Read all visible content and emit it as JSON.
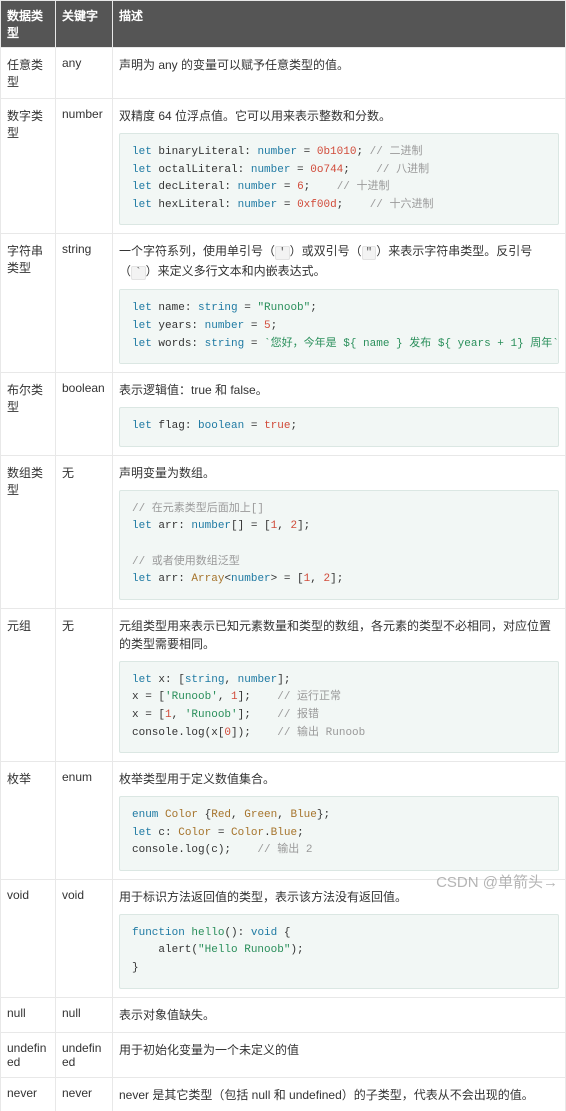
{
  "headers": {
    "col1": "数据类型",
    "col2": "关键字",
    "col3": "描述"
  },
  "rows": {
    "any": {
      "type": "任意类型",
      "kw": "any",
      "desc": "声明为 any 的变量可以赋予任意类型的值。"
    },
    "number": {
      "type": "数字类型",
      "kw": "number",
      "desc": "双精度 64 位浮点值。它可以用来表示整数和分数。",
      "code": {
        "l1a": "let",
        "l1b": " binaryLiteral: ",
        "l1c": "number",
        "l1d": " = ",
        "l1e": "0b1010",
        "l1f": "; ",
        "l1g": "// 二进制",
        "l2a": "let",
        "l2b": " octalLiteral: ",
        "l2c": "number",
        "l2d": " = ",
        "l2e": "0o744",
        "l2f": ";    ",
        "l2g": "// 八进制",
        "l3a": "let",
        "l3b": " decLiteral: ",
        "l3c": "number",
        "l3d": " = ",
        "l3e": "6",
        "l3f": ";    ",
        "l3g": "// 十进制",
        "l4a": "let",
        "l4b": " hexLiteral: ",
        "l4c": "number",
        "l4d": " = ",
        "l4e": "0xf00d",
        "l4f": ";    ",
        "l4g": "// 十六进制"
      }
    },
    "string": {
      "type": "字符串类型",
      "kw": "string",
      "desc_pre": "一个字符系列，使用单引号（",
      "q1": "'",
      "desc_mid1": "）或双引号（",
      "q2": "\"",
      "desc_mid2": "）来表示字符串类型。反引号（",
      "q3": "`",
      "desc_post": "）来定义多行文本和内嵌表达式。",
      "code": {
        "l1a": "let",
        "l1b": " name: ",
        "l1c": "string",
        "l1d": " = ",
        "l1e": "\"Runoob\"",
        "l1f": ";",
        "l2a": "let",
        "l2b": " years: ",
        "l2c": "number",
        "l2d": " = ",
        "l2e": "5",
        "l2f": ";",
        "l3a": "let",
        "l3b": " words: ",
        "l3c": "string",
        "l3d": " = ",
        "l3e": "`您好，今年是 ${ name } 发布 ${ years + 1} 周年`",
        "l3f": ";"
      }
    },
    "boolean": {
      "type": "布尔类型",
      "kw": "boolean",
      "desc": "表示逻辑值：true 和 false。",
      "code": {
        "l1a": "let",
        "l1b": " flag: ",
        "l1c": "boolean",
        "l1d": " = ",
        "l1e": "true",
        "l1f": ";"
      }
    },
    "array": {
      "type": "数组类型",
      "kw": "无",
      "desc": "声明变量为数组。",
      "code": {
        "c1": "// 在元素类型后面加上[]",
        "l1a": "let",
        "l1b": " arr: ",
        "l1c": "number",
        "l1d": "[] = [",
        "l1e": "1",
        "l1f": ", ",
        "l1g": "2",
        "l1h": "];",
        "c2": "// 或者使用数组泛型",
        "l2a": "let",
        "l2b": " arr: ",
        "l2c": "Array",
        "l2d": "<",
        "l2e": "number",
        "l2f": "> = [",
        "l2g": "1",
        "l2h": ", ",
        "l2i": "2",
        "l2j": "];"
      }
    },
    "tuple": {
      "type": "元组",
      "kw": "无",
      "desc": "元组类型用来表示已知元素数量和类型的数组，各元素的类型不必相同，对应位置的类型需要相同。",
      "code": {
        "l1a": "let",
        "l1b": " x: [",
        "l1c": "string",
        "l1d": ", ",
        "l1e": "number",
        "l1f": "];",
        "l2a": "x = [",
        "l2b": "'Runoob'",
        "l2c": ", ",
        "l2d": "1",
        "l2e": "];    ",
        "l2f": "// 运行正常",
        "l3a": "x = [",
        "l3b": "1",
        "l3c": ", ",
        "l3d": "'Runoob'",
        "l3e": "];    ",
        "l3f": "// 报错",
        "l4a": "console.log(x[",
        "l4b": "0",
        "l4c": "]);    ",
        "l4d": "// 输出 Runoob"
      }
    },
    "enum": {
      "type": "枚举",
      "kw": "enum",
      "desc": "枚举类型用于定义数值集合。",
      "code": {
        "l1a": "enum",
        "l1b": " ",
        "l1c": "Color",
        "l1d": " {",
        "l1e": "Red",
        "l1f": ", ",
        "l1g": "Green",
        "l1h": ", ",
        "l1i": "Blue",
        "l1j": "};",
        "l2a": "let",
        "l2b": " c: ",
        "l2c": "Color",
        "l2d": " = ",
        "l2e": "Color",
        "l2f": ".",
        "l2g": "Blue",
        "l2h": ";",
        "l3a": "console.log(c);    ",
        "l3b": "// 输出 2"
      }
    },
    "void": {
      "type": "void",
      "kw": "void",
      "desc": "用于标识方法返回值的类型，表示该方法没有返回值。",
      "code": {
        "l1a": "function",
        "l1b": " ",
        "l1c": "hello",
        "l1d": "(): ",
        "l1e": "void",
        "l1f": " {",
        "l2a": "    alert(",
        "l2b": "\"Hello Runoob\"",
        "l2c": ");",
        "l3": "}"
      }
    },
    "null": {
      "type": "null",
      "kw": "null",
      "desc": "表示对象值缺失。"
    },
    "undef": {
      "type": "undefined",
      "kw": "undefined",
      "desc": "用于初始化变量为一个未定义的值"
    },
    "never": {
      "type": "never",
      "kw": "never",
      "desc": "never 是其它类型（包括 null 和 undefined）的子类型，代表从不会出现的值。"
    }
  },
  "watermark": "CSDN @单箭头→"
}
